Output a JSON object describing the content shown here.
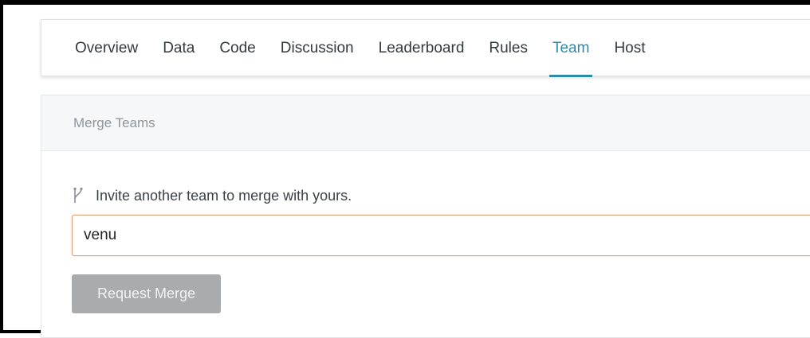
{
  "nav": {
    "tabs": [
      {
        "label": "Overview"
      },
      {
        "label": "Data"
      },
      {
        "label": "Code"
      },
      {
        "label": "Discussion"
      },
      {
        "label": "Leaderboard"
      },
      {
        "label": "Rules"
      },
      {
        "label": "Team"
      },
      {
        "label": "Host"
      }
    ],
    "active": "Team"
  },
  "merge": {
    "title": "Merge Teams",
    "hint_icon": "merge-branch-icon",
    "hint": "Invite another team to merge with yours.",
    "input_value": "venu",
    "button_label": "Request Merge"
  },
  "colors": {
    "accent": "#2f8ba6",
    "input_focus_border": "#d9a17c",
    "button_disabled": "#a9abad"
  }
}
